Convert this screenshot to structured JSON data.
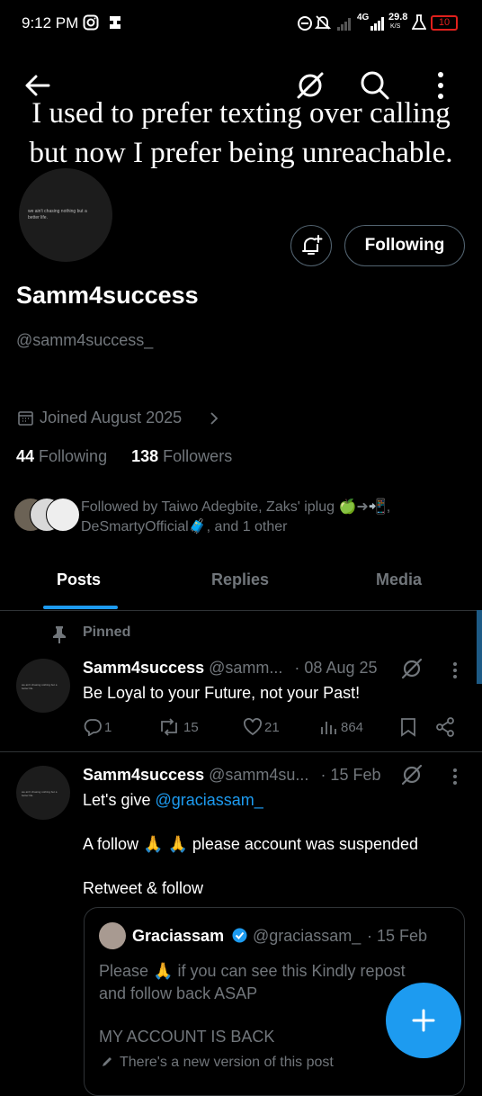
{
  "status_bar": {
    "time": "9:12 PM",
    "network": "4G",
    "speed": "29.8",
    "speed_unit": "K/S",
    "battery": "10"
  },
  "banner": {
    "line1": "I used to prefer texting over calling",
    "line2": "but now I prefer being unreachable."
  },
  "avatar_text": "we ain't chasing nothing but a better life.",
  "profile": {
    "name": "Samm4success",
    "handle": "@samm4success_",
    "joined": "Joined August 2025",
    "following_count": "44",
    "following_label": "Following",
    "followers_count": "138",
    "followers_label": "Followers",
    "follow_button": "Following",
    "followed_by": "Followed by Taiwo Adegbite, Zaks' iplug 🍏➜📲, DeSmartyOfficial🧳, and 1 other"
  },
  "tabs": [
    "Posts",
    "Replies",
    "Media"
  ],
  "posts": [
    {
      "pinned_label": "Pinned",
      "name": "Samm4success",
      "handle": "@samm...",
      "date": "· 08 Aug 25",
      "text": "Be Loyal to your Future, not your Past!",
      "replies": "1",
      "reposts": "15",
      "likes": "21",
      "views": "864"
    },
    {
      "name": "Samm4success",
      "handle": "@samm4su...",
      "date": "· 15 Feb",
      "text_prefix": "Let's give ",
      "mention": "@graciassam_",
      "line2": "A follow 🙏 🙏 please account was suspended",
      "line3": "Retweet & follow",
      "quote": {
        "name": "Graciassam",
        "handle": "@graciassam_",
        "date": "· 15 Feb",
        "text1": "Please 🙏 if you can see this Kindly repost",
        "text2": "and follow back ASAP",
        "text3": "MY ACCOUNT IS BACK",
        "notice": "There's a new version of this post"
      }
    }
  ],
  "colors": {
    "accent": "#1d9bf0",
    "muted": "#71767b",
    "border": "#2f3336"
  }
}
